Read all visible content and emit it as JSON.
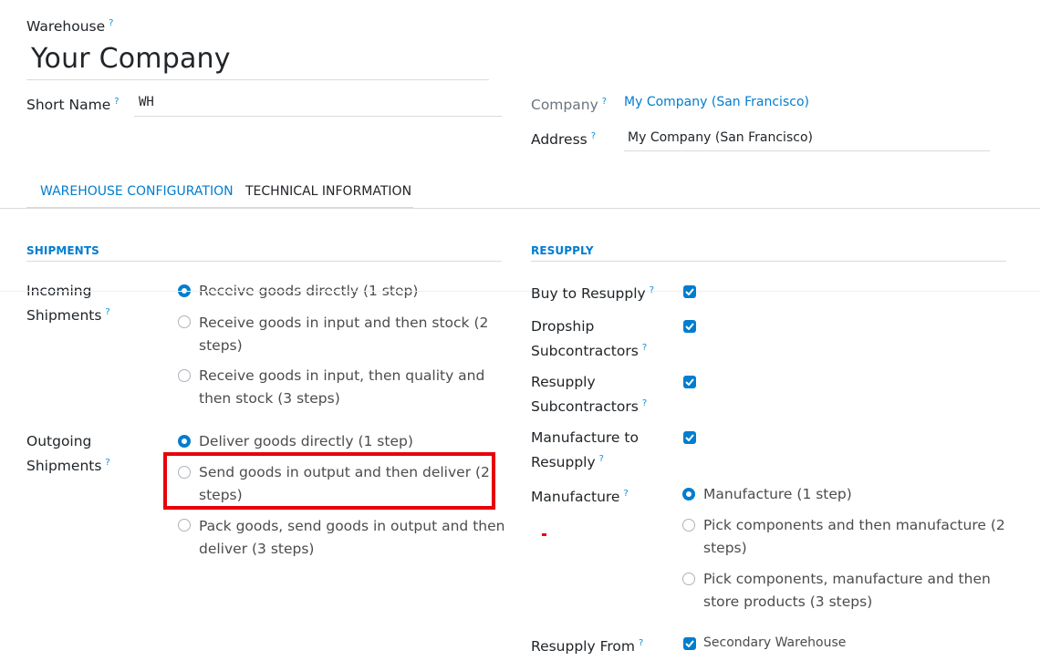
{
  "header": {
    "warehouse_label": "Warehouse",
    "warehouse_name": "Your Company",
    "short_name_label": "Short Name",
    "short_name_value": "WH",
    "company_label": "Company",
    "company_value": "My Company (San Francisco)",
    "address_label": "Address",
    "address_value": "My Company (San Francisco)",
    "help_mark": "?"
  },
  "tabs": [
    {
      "label": "WAREHOUSE CONFIGURATION",
      "active": true
    },
    {
      "label": "TECHNICAL INFORMATION",
      "active": false
    }
  ],
  "shipments": {
    "title": "SHIPMENTS",
    "incoming_label_1": "Incoming",
    "incoming_label_2": "Shipments",
    "incoming_options": [
      {
        "label_1": "Receive goods directly (1 step)",
        "label_2": "",
        "selected": true
      },
      {
        "label_1": "Receive goods in input and then stock (2",
        "label_2": "steps)",
        "selected": false
      },
      {
        "label_1": "Receive goods in input, then quality and",
        "label_2": "then stock (3 steps)",
        "selected": false
      }
    ],
    "outgoing_label_1": "Outgoing",
    "outgoing_label_2": "Shipments",
    "outgoing_options": [
      {
        "label_1": "Deliver goods directly (1 step)",
        "label_2": "",
        "selected": true
      },
      {
        "label_1": "Send goods in output and then deliver (2",
        "label_2": "steps)",
        "selected": false
      },
      {
        "label_1": "Pack goods, send goods in output and then",
        "label_2": "deliver (3 steps)",
        "selected": false
      }
    ]
  },
  "resupply": {
    "title": "RESUPPLY",
    "buy_label": "Buy to Resupply",
    "dropship_label_1": "Dropship",
    "dropship_label_2": "Subcontractors",
    "resupply_sub_label_1": "Resupply",
    "resupply_sub_label_2": "Subcontractors",
    "manufacture_to_label_1": "Manufacture to",
    "manufacture_to_label_2": "Resupply",
    "checks": {
      "buy": true,
      "dropship": true,
      "resupply_sub": true,
      "manufacture_to": true
    },
    "manufacture_label": "Manufacture",
    "manufacture_options": [
      {
        "label_1": "Manufacture (1 step)",
        "label_2": "",
        "selected": true
      },
      {
        "label_1": "Pick components and then manufacture (2",
        "label_2": "steps)",
        "selected": false
      },
      {
        "label_1": "Pick components, manufacture and then",
        "label_2": "store products (3 steps)",
        "selected": false
      }
    ],
    "resupply_from_label": "Resupply From",
    "resupply_from_value": "Secondary Warehouse",
    "resupply_from_checked": true
  },
  "colors": {
    "accent": "#017dcf",
    "highlight_box": "#e8000b",
    "link": "#017dcf"
  }
}
